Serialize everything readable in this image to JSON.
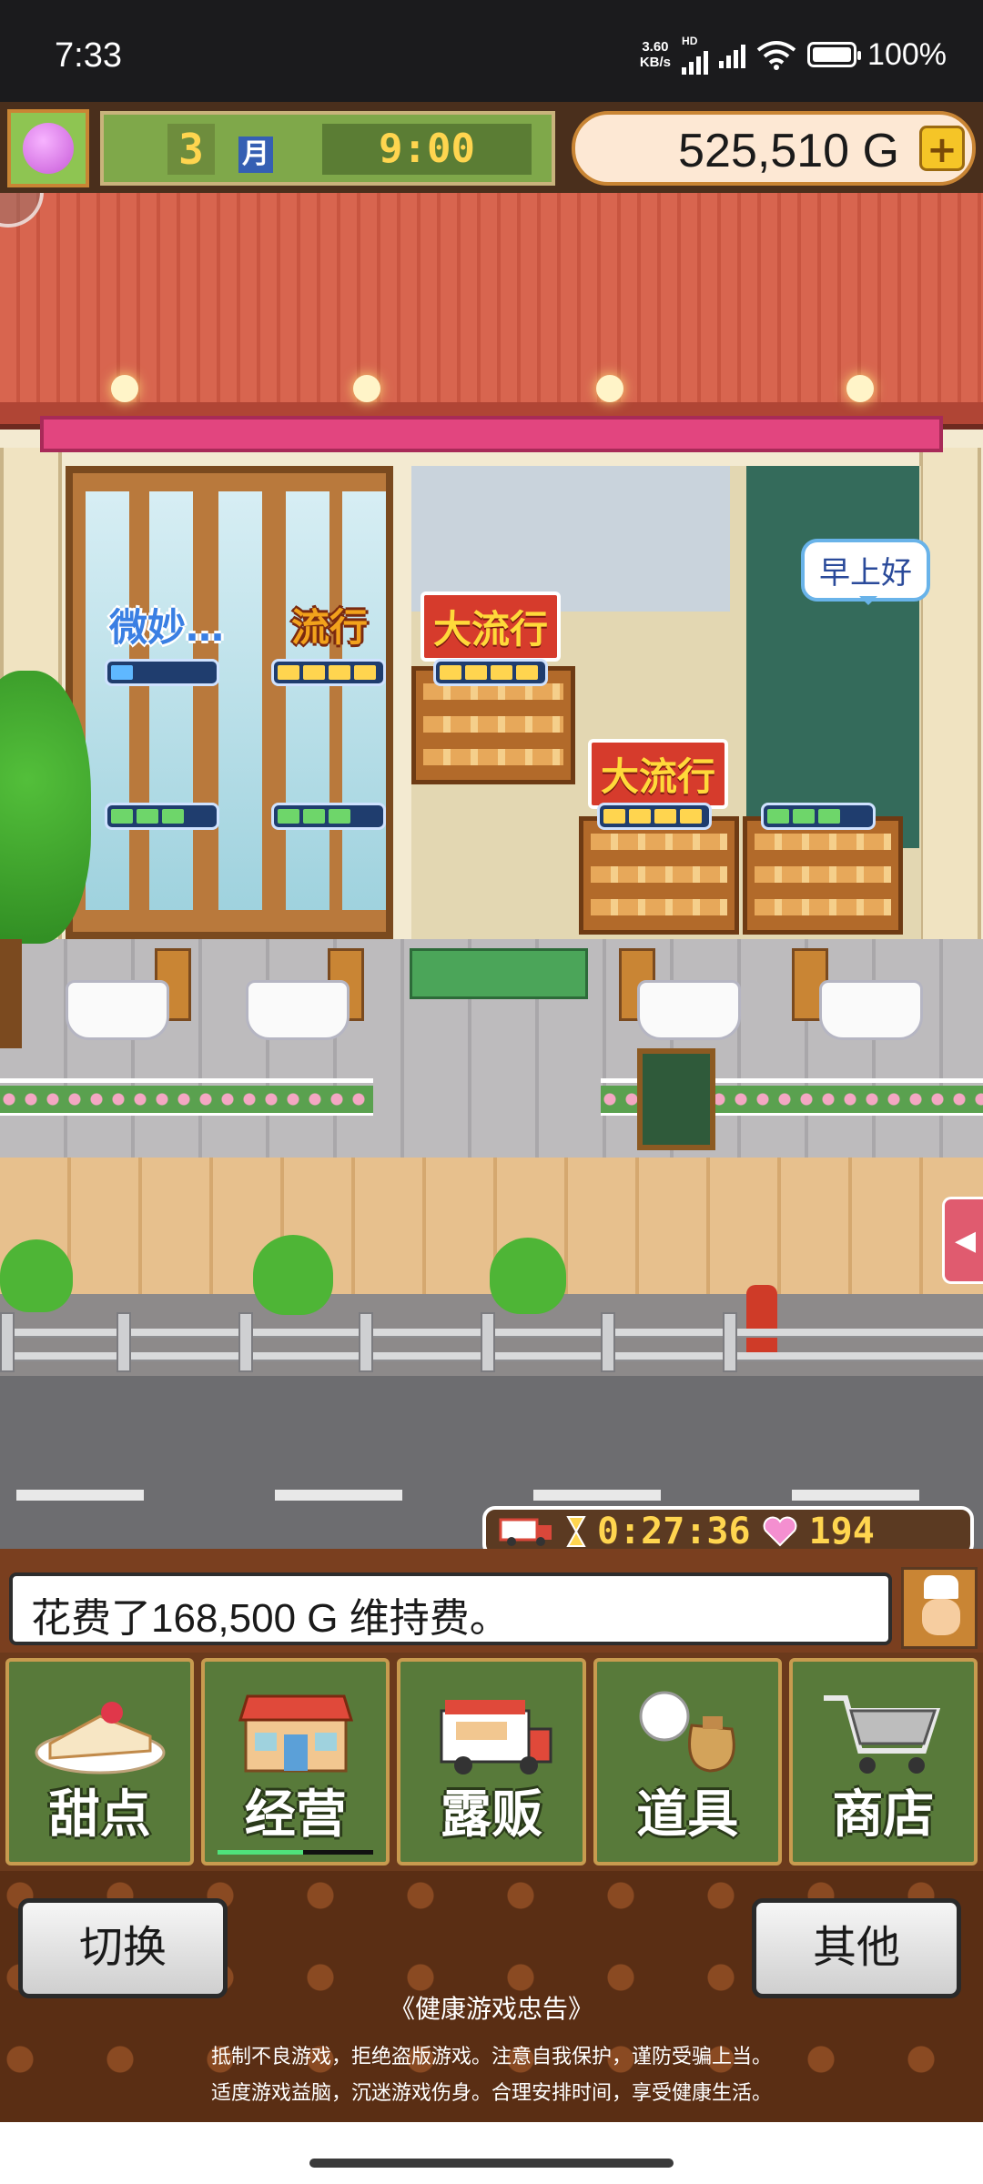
{
  "status_bar": {
    "time": "7:33",
    "net_speed_value": "3.60",
    "net_speed_unit": "KB/s",
    "hd_label": "HD",
    "battery_pct": "100%"
  },
  "hud": {
    "month_number": "3",
    "month_label": "月",
    "clock": "9:00",
    "money": "525,510 G",
    "add_money_label": "+"
  },
  "scene": {
    "tags": [
      {
        "text": "微妙…",
        "style": "blue"
      },
      {
        "text": "流行",
        "style": "orange"
      },
      {
        "text": "大流行",
        "style": "red"
      },
      {
        "text": "大流行",
        "style": "red"
      }
    ],
    "speech_bubble": "早上好",
    "timer": "0:27:36",
    "hearts": "194",
    "side_tab_icon": "◀"
  },
  "message": "花费了168,500 G 维持费。",
  "menu": [
    {
      "label": "甜点",
      "icon": "cake-icon",
      "active": false
    },
    {
      "label": "经营",
      "icon": "shop-icon",
      "active": true
    },
    {
      "label": "露贩",
      "icon": "food-truck-icon",
      "active": false
    },
    {
      "label": "道具",
      "icon": "item-bag-icon",
      "active": false
    },
    {
      "label": "商店",
      "icon": "shopping-cart-icon",
      "active": false
    }
  ],
  "bottom": {
    "switch_label": "切换",
    "other_label": "其他",
    "notice_title": "《健康游戏忠告》",
    "notice_line1": "抵制不良游戏，拒绝盗版游戏。注意自我保护，谨防受骗上当。",
    "notice_line2": "适度游戏益脑，沉迷游戏伤身。合理安排时间，享受健康生活。"
  }
}
